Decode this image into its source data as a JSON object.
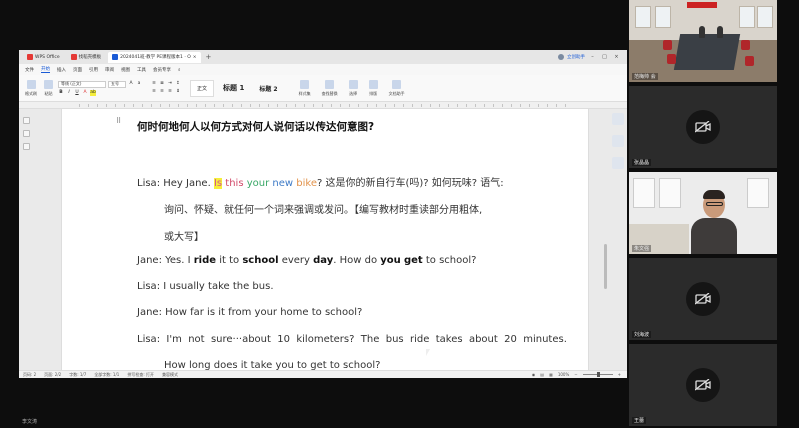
{
  "wps": {
    "tabs": [
      {
        "label": "WPS Office",
        "color": "#e53935"
      },
      {
        "label": "找稻壳模板",
        "color": "#e53935"
      },
      {
        "label": "2024041班·教学 PE课程版本1 · O",
        "color": "#1a5bd6"
      }
    ],
    "user_name": "立创助手",
    "menu": [
      "文件",
      "开始",
      "插入",
      "页面",
      "引用",
      "审阅",
      "视图",
      "工具",
      "会员专享"
    ],
    "active_menu": "开始",
    "ribbon": {
      "format_painter": "格式刷",
      "paste": "粘贴",
      "font_name": "等线 (正文)",
      "font_size": "五号",
      "style_normal": "正文",
      "style_h1": "标题 1",
      "style_h2": "标题 2",
      "tools": [
        "样式集",
        "查找替换",
        "选择",
        "排版",
        "文档助手"
      ]
    },
    "document": {
      "heading": "何时何地何人以何方式对何人说何话以传达何意图?",
      "lisa1_prefix": "Lisa: Hey Jane. ",
      "lisa1_w1": "Is",
      "lisa1_w2": " this",
      "lisa1_w3": " your",
      "lisa1_w4": " new",
      "lisa1_w5": " bike",
      "lisa1_cn": "? 这是你的新自行车(吗)? 如何玩味? 语气:",
      "lisa1_note1": "询问、怀疑、就任何一个词来强调或发问。【编写教材时重读部分用粗体,",
      "lisa1_note2": "或大写】",
      "jane1_a": "Jane: Yes. I ",
      "jane1_ride": "ride",
      "jane1_b": " it to ",
      "jane1_school": "school",
      "jane1_c": " every ",
      "jane1_day": "day",
      "jane1_d": ". How do ",
      "jane1_you": "you",
      "jane1_e": " ",
      "jane1_get": "get",
      "jane1_f": " to school?",
      "lisa2": "Lisa: I usually take the bus.",
      "jane2": "Jane: How far is it from your home to school?",
      "lisa3": "Lisa:  I'm  not  sure···about  10  kilometers?  The  bus  ride  takes  about  20  minutes.",
      "jane3_partial": "How long does it take you to get to school?"
    },
    "status": {
      "page": "页码: 2",
      "pages": "页面: 2/2",
      "words": "字数: 1/7",
      "words2": "全部字数: 1/1",
      "spell": "拼写检查: 打开",
      "compat": "兼容模式",
      "zoom": "100%"
    }
  },
  "host_label": "李文涛",
  "participants": [
    {
      "name": "范梅帅 会",
      "video": "conference-room"
    },
    {
      "name": "张晶晶",
      "video": "off"
    },
    {
      "name": "朱文强",
      "video": "webcam"
    },
    {
      "name": "刘海波",
      "video": "off"
    },
    {
      "name": "王蕾",
      "video": "off"
    }
  ]
}
